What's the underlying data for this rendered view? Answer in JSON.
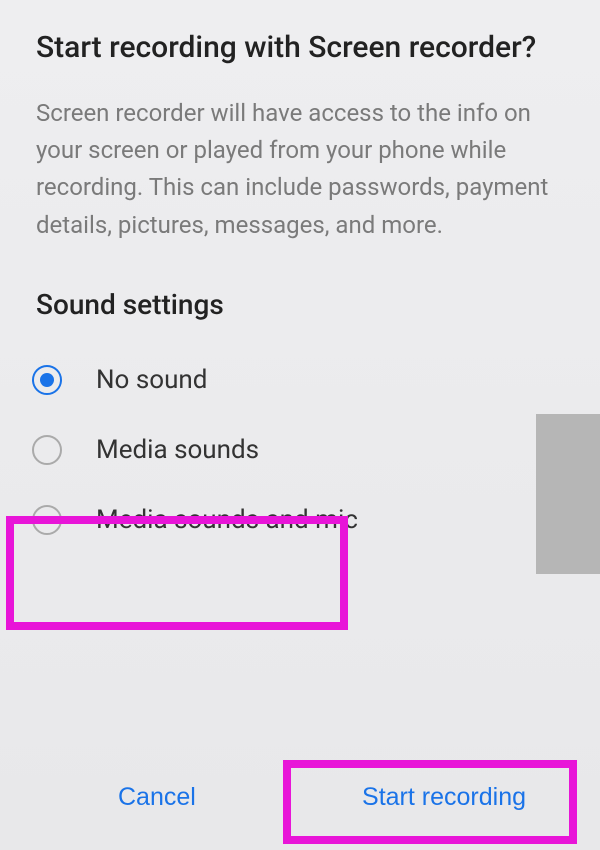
{
  "dialog": {
    "title": "Start recording with Screen recorder?",
    "body": "Screen recorder will have access to the info on your screen or played from your phone while recording. This can include passwords, payment details, pictures, messages, and more."
  },
  "section": {
    "heading": "Sound settings"
  },
  "options": [
    {
      "label": "No sound",
      "selected": true
    },
    {
      "label": "Media sounds",
      "selected": false
    },
    {
      "label": "Media sounds and mic",
      "selected": false
    }
  ],
  "actions": {
    "cancel": "Cancel",
    "confirm": "Start recording"
  },
  "colors": {
    "accent": "#1a73e8",
    "highlight": "#e815d8"
  }
}
